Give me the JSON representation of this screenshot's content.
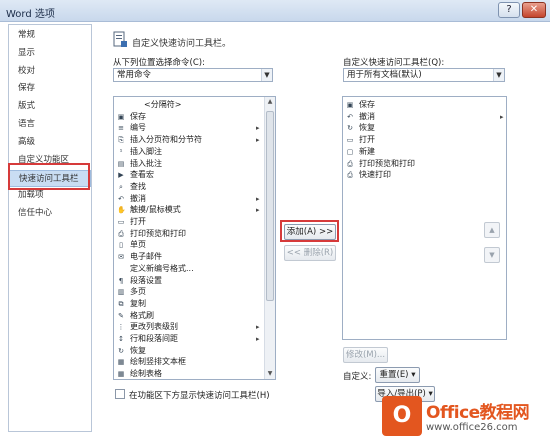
{
  "window": {
    "title": "Word 选项",
    "help_label": "?",
    "close_label": "✕"
  },
  "nav": {
    "items": [
      {
        "label": "常规",
        "active": false
      },
      {
        "label": "显示",
        "active": false
      },
      {
        "label": "校对",
        "active": false
      },
      {
        "label": "保存",
        "active": false
      },
      {
        "label": "版式",
        "active": false
      },
      {
        "label": "语言",
        "active": false
      },
      {
        "label": "高级",
        "active": false
      },
      {
        "label": "自定义功能区",
        "active": false
      },
      {
        "label": "快速访问工具栏",
        "active": true
      },
      {
        "label": "加载项",
        "active": false
      },
      {
        "label": "信任中心",
        "active": false
      }
    ]
  },
  "header": {
    "text": "自定义快速访问工具栏。"
  },
  "left": {
    "label": "从下列位置选择命令(C):",
    "selected": "常用命令",
    "items": [
      {
        "icon": "",
        "label": "<分隔符>",
        "sub": ""
      },
      {
        "icon": "save-icon",
        "label": "保存",
        "sub": ""
      },
      {
        "icon": "list-icon",
        "label": "编号",
        "sub": "▸"
      },
      {
        "icon": "page-break-icon",
        "label": "插入分页符和分节符",
        "sub": "▸"
      },
      {
        "icon": "footnote-icon",
        "label": "插入脚注",
        "sub": ""
      },
      {
        "icon": "comment-icon",
        "label": "插入批注",
        "sub": ""
      },
      {
        "icon": "arrow-icon",
        "label": "查看宏",
        "sub": ""
      },
      {
        "icon": "find-icon",
        "label": "查找",
        "sub": ""
      },
      {
        "icon": "undo-icon",
        "label": "撤消",
        "sub": "▸"
      },
      {
        "icon": "touch-icon",
        "label": "触摸/鼠标模式",
        "sub": "▸"
      },
      {
        "icon": "folder-icon",
        "label": "打开",
        "sub": ""
      },
      {
        "icon": "print-preview-icon",
        "label": "打印预览和打印",
        "sub": ""
      },
      {
        "icon": "page-icon",
        "label": "单页",
        "sub": ""
      },
      {
        "icon": "mail-icon",
        "label": "电子邮件",
        "sub": ""
      },
      {
        "icon": "",
        "label": "定义新编号格式...",
        "sub": ""
      },
      {
        "icon": "paragraph-icon",
        "label": "段落设置",
        "sub": ""
      },
      {
        "icon": "multi-page-icon",
        "label": "多页",
        "sub": ""
      },
      {
        "icon": "copy-icon",
        "label": "复制",
        "sub": ""
      },
      {
        "icon": "brush-icon",
        "label": "格式刷",
        "sub": ""
      },
      {
        "icon": "list-level-icon",
        "label": "更改列表级别",
        "sub": "▸"
      },
      {
        "icon": "line-spacing-icon",
        "label": "行和段落间距",
        "sub": "▸"
      },
      {
        "icon": "redo-icon",
        "label": "恢复",
        "sub": ""
      },
      {
        "icon": "textbox-icon",
        "label": "绘制竖排文本框",
        "sub": ""
      },
      {
        "icon": "table-icon",
        "label": "绘制表格",
        "sub": ""
      }
    ]
  },
  "right": {
    "label": "自定义快速访问工具栏(Q):",
    "selected": "用于所有文档(默认)",
    "items": [
      {
        "icon": "save-icon",
        "label": "保存",
        "sub": ""
      },
      {
        "icon": "undo-icon",
        "label": "撤消",
        "sub": "▸"
      },
      {
        "icon": "redo-icon",
        "label": "恢复",
        "sub": ""
      },
      {
        "icon": "folder-icon",
        "label": "打开",
        "sub": ""
      },
      {
        "icon": "new-doc-icon",
        "label": "新建",
        "sub": ""
      },
      {
        "icon": "print-preview-icon",
        "label": "打印预览和打印",
        "sub": ""
      },
      {
        "icon": "quick-print-icon",
        "label": "快速打印",
        "sub": ""
      }
    ]
  },
  "buttons": {
    "add": "添加(A) >>",
    "remove": "<< 删除(R)",
    "modify": "修改(M)...",
    "reset": "重置(E) ▾",
    "import_export": "导入/导出(P) ▾"
  },
  "customize_label": "自定义:",
  "checkbox_label": "在功能区下方显示快速访问工具栏(H)",
  "watermark": {
    "line1": "Office教程网",
    "line2": "www.office26.com",
    "logo": "O"
  },
  "colors": {
    "highlight": "#d63a3a",
    "selection": "#c9ddf3",
    "accent": "#e3561f"
  }
}
